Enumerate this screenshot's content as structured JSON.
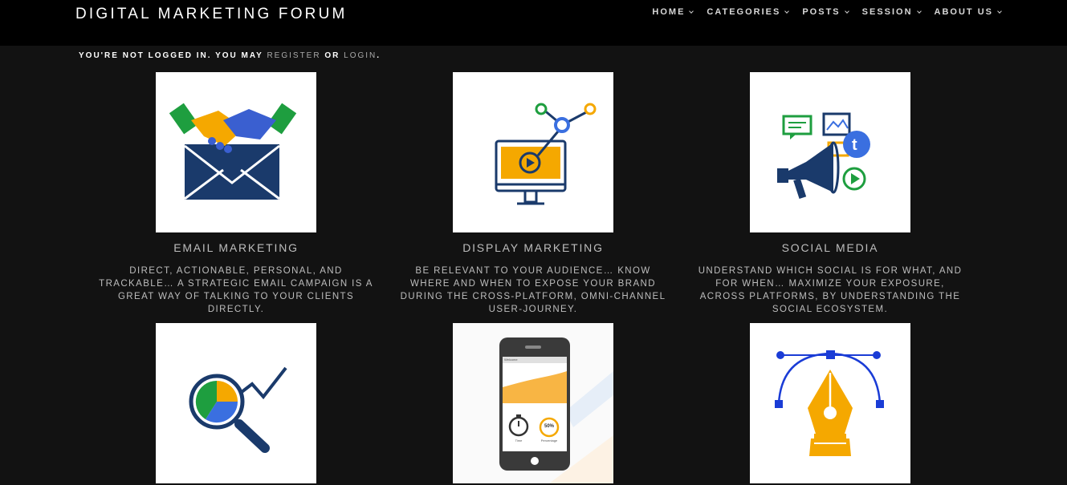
{
  "header": {
    "site_title": "DIGITAL MARKETING FORUM",
    "nav": [
      {
        "label": "HOME"
      },
      {
        "label": "CATEGORIES"
      },
      {
        "label": "POSTS"
      },
      {
        "label": "SESSION"
      },
      {
        "label": "ABOUT US"
      }
    ]
  },
  "login_notice": {
    "prefix": "YOU'RE NOT LOGGED IN. YOU MAY",
    "register": "REGISTER",
    "or": "OR",
    "login": "LOGIN",
    "suffix": "."
  },
  "cards": [
    {
      "title": "EMAIL MARKETING",
      "description": "DIRECT, ACTIONABLE, PERSONAL, AND TRACKABLE… A STRATEGIC EMAIL CAMPAIGN IS A GREAT WAY OF TALKING TO YOUR CLIENTS DIRECTLY.",
      "icon": "handshake-envelope-icon"
    },
    {
      "title": "DISPLAY MARKETING",
      "description": "BE RELEVANT TO YOUR AUDIENCE… KNOW WHERE AND WHEN TO EXPOSE YOUR BRAND DURING THE CROSS-PLATFORM, OMNI-CHANNEL USER-JOURNEY.",
      "icon": "monitor-play-icon"
    },
    {
      "title": "SOCIAL MEDIA",
      "description": "UNDERSTAND WHICH SOCIAL IS FOR WHAT, AND FOR WHEN… MAXIMIZE YOUR EXPOSURE, ACROSS PLATFORMS, BY UNDERSTANDING THE SOCIAL ECOSYSTEM.",
      "icon": "megaphone-social-icon"
    },
    {
      "title": "",
      "description": "",
      "icon": "analytics-magnifier-icon"
    },
    {
      "title": "",
      "description": "",
      "icon": "mobile-app-icon",
      "phone": {
        "header": "Welcome",
        "percent": "50%",
        "label_left": "Time",
        "label_right": "Percentage"
      }
    },
    {
      "title": "",
      "description": "",
      "icon": "pen-tool-icon"
    }
  ],
  "colors": {
    "background": "#121212",
    "topbar": "#000000",
    "accent_blue": "#1a3a6b",
    "accent_orange": "#f5a800",
    "accent_green": "#1e9e3f"
  }
}
